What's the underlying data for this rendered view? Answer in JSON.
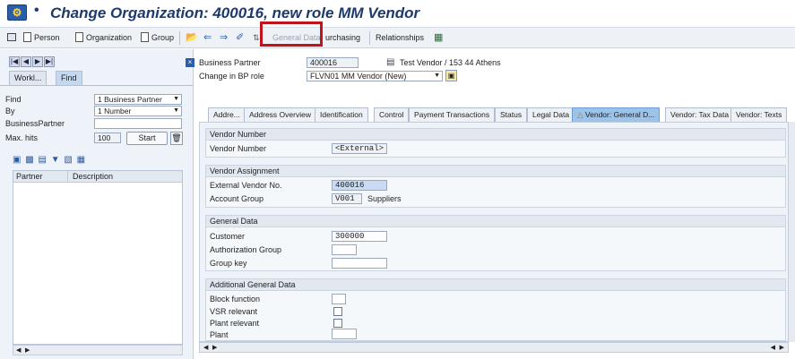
{
  "window": {
    "title": "Change Organization: 400016, new role MM Vendor",
    "title_icon": "bp-icon"
  },
  "toolbar": {
    "person": "Person",
    "organization": "Organization",
    "group": "Group",
    "general_data": "General Data",
    "purchasing": "urchasing",
    "relationships": "Relationships"
  },
  "left": {
    "tabs": [
      "Workl...",
      "Find"
    ],
    "find_label": "Find",
    "find_value": "1 Business Partner",
    "by_label": "By",
    "by_value": "1 Number",
    "bp_label": "BusinessPartner",
    "bp_value": "",
    "maxhits_label": "Max. hits",
    "maxhits_value": "100",
    "start_label": "Start",
    "grid_cols": [
      "Partner",
      "Description"
    ]
  },
  "header": {
    "bp_label": "Business Partner",
    "bp_value": "400016",
    "bp_desc": "Test Vendor / 153 44 Athens",
    "role_label": "Change in BP role",
    "role_value": "FLVN01 MM Vendor (New)"
  },
  "tabs": [
    "Addre...",
    "Address Overview",
    "Identification",
    "Control",
    "Payment Transactions",
    "Status",
    "Legal Data",
    "Vendor: General D...",
    "Vendor: Tax Data",
    "Vendor: Texts"
  ],
  "groups": {
    "vendor_number": {
      "title": "Vendor Number",
      "label": "Vendor Number",
      "value": "<External>"
    },
    "vendor_assignment": {
      "title": "Vendor Assignment",
      "ext_label": "External Vendor No.",
      "ext_value": "400016",
      "acct_label": "Account Group",
      "acct_value": "V001",
      "acct_desc": "Suppliers"
    },
    "general_data": {
      "title": "General Data",
      "customer_label": "Customer",
      "customer_value": "300000",
      "auth_label": "Authorization Group",
      "auth_value": "",
      "group_label": "Group key",
      "group_value": ""
    },
    "additional": {
      "title": "Additional General Data",
      "block_label": "Block function",
      "vsr_label": "VSR relevant",
      "plant_rel_label": "Plant relevant",
      "plant_label": "Plant"
    }
  },
  "colors": {
    "title": "#1d3a6e",
    "active_tab": "#9cc3ea",
    "highlight_box": "#c0141a"
  }
}
